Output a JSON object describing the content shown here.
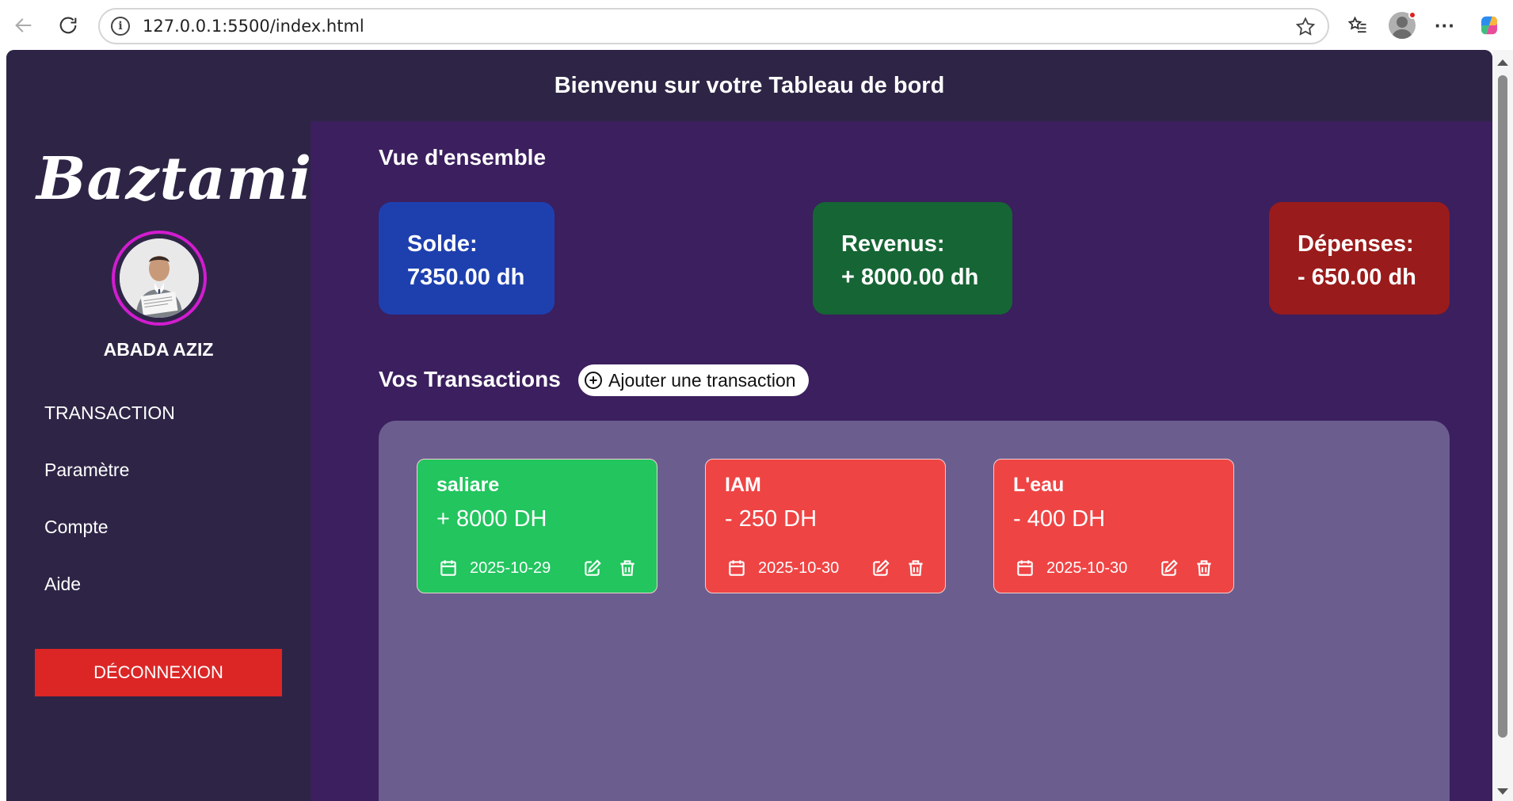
{
  "browser": {
    "url": "127.0.0.1:5500/index.html"
  },
  "header": {
    "title": "Bienvenu sur votre Tableau de bord"
  },
  "sidebar": {
    "logo": "Baztami",
    "user_name": "ABADA AZIZ",
    "items": [
      {
        "label": "TRANSACTION"
      },
      {
        "label": "Paramètre"
      },
      {
        "label": "Compte"
      },
      {
        "label": "Aide"
      }
    ],
    "logout_label": "DÉCONNEXION"
  },
  "overview": {
    "title": "Vue d'ensemble",
    "cards": [
      {
        "label": "Solde:",
        "value": "7350.00 dh",
        "color": "#1e40af"
      },
      {
        "label": "Revenus:",
        "value": "+ 8000.00 dh",
        "color": "#166534"
      },
      {
        "label": "Dépenses:",
        "value": "- 650.00 dh",
        "color": "#991b1b"
      }
    ]
  },
  "transactions": {
    "title": "Vos Transactions",
    "add_label": "Ajouter une transaction",
    "items": [
      {
        "title": "saliare",
        "amount": "+ 8000 DH",
        "date": "2025-10-29",
        "color": "#22c55e"
      },
      {
        "title": "IAM",
        "amount": "- 250 DH",
        "date": "2025-10-30",
        "color": "#ef4444"
      },
      {
        "title": "L'eau",
        "amount": "- 400 DH",
        "date": "2025-10-30",
        "color": "#ef4444"
      }
    ]
  },
  "colors": {
    "page_bg": "#3b1f5e",
    "sidebar_bg": "#2e2546",
    "panel_bg": "#6b5e8f",
    "logout": "#dc2626",
    "avatar_ring": "#d21cd0"
  }
}
